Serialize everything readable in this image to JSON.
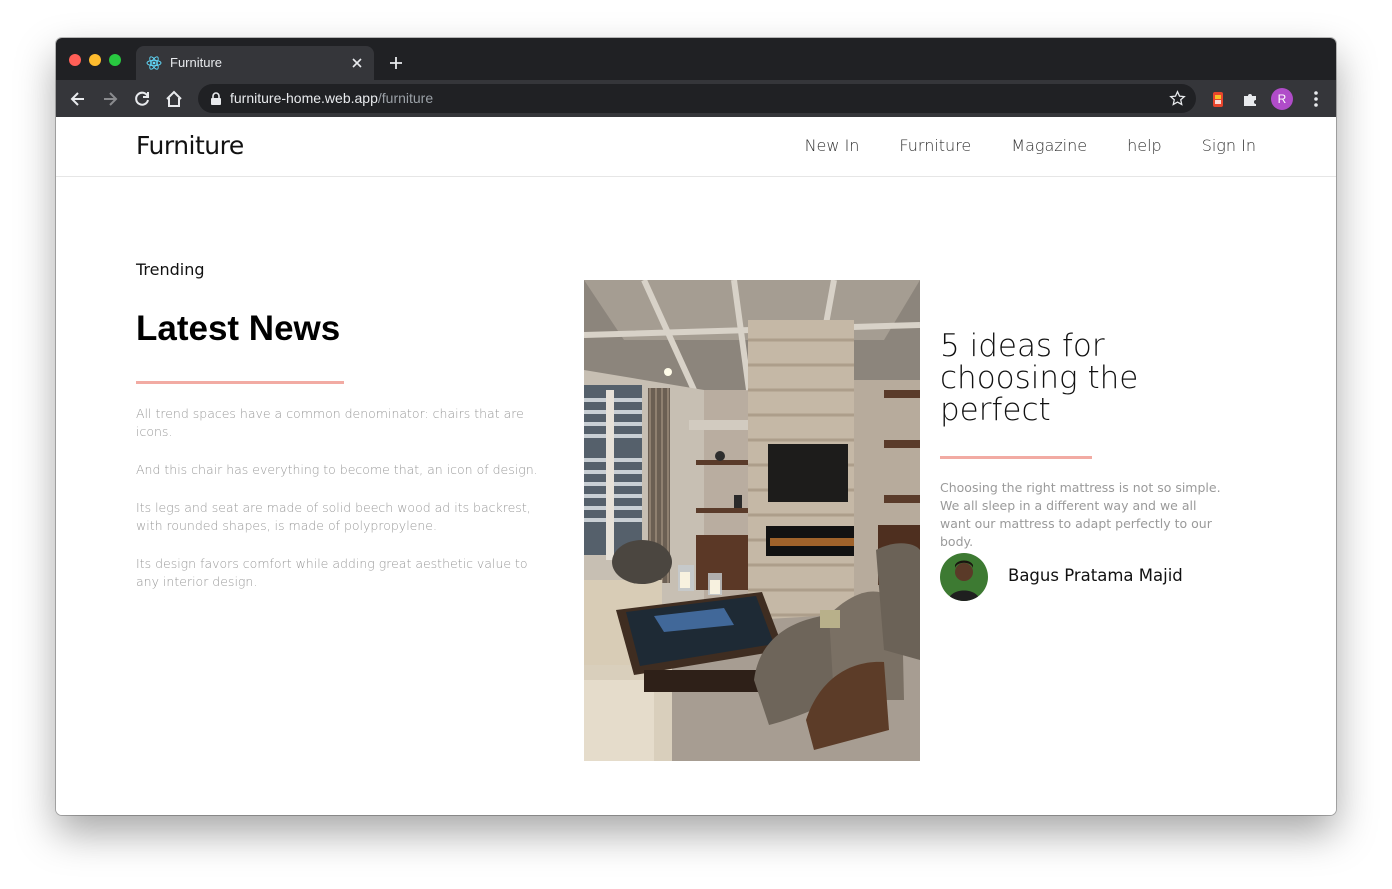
{
  "browser": {
    "tab_title": "Furniture",
    "url_host": "furniture-home.web.app",
    "url_path": "/furniture",
    "profile_initial": "R"
  },
  "site": {
    "brand": "Furniture",
    "nav": [
      "New In",
      "Furniture",
      "Magazine",
      "help",
      "Sign In"
    ]
  },
  "trending": {
    "eyebrow": "Trending",
    "heading": "Latest News",
    "paragraphs": [
      "All trend spaces have a common denominator: chairs that are icons.",
      "And this chair has everything to become that, an icon of design.",
      "Its legs and seat are made of solid beech wood ad its backrest, with rounded shapes, is made of polypropylene.",
      "Its design favors comfort while adding great aesthetic value to any interior design."
    ]
  },
  "article": {
    "title": "5 ideas for choosing the perfect",
    "excerpt": "Choosing the right mattress is not so simple. We all sleep in a different way and we all want our mattress to adapt perfectly to our body.",
    "author": "Bagus Pratama Majid"
  },
  "colors": {
    "accent_rule": "#f2aba3",
    "chrome_dark": "#202124",
    "profile": "#b04cc9"
  }
}
